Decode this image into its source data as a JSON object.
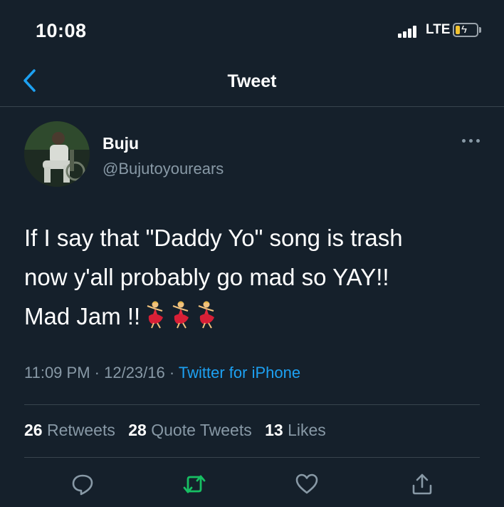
{
  "status_bar": {
    "time": "10:08",
    "network": "LTE"
  },
  "nav": {
    "title": "Tweet"
  },
  "author": {
    "name": "Buju",
    "handle": "@Bujutoyourears"
  },
  "tweet": {
    "line1": "If I say that \"Daddy Yo\" song is trash",
    "line2": "now y'all probably go mad so YAY!!",
    "line3": "Mad Jam !!",
    "emojis": [
      "dancer-emoji",
      "dancer-emoji",
      "dancer-emoji"
    ]
  },
  "meta": {
    "time": "11:09 PM",
    "date": "12/23/16",
    "sep": " · ",
    "source": "Twitter for iPhone"
  },
  "stats": {
    "retweets_count": "26",
    "retweets_label": "Retweets",
    "quotes_count": "28",
    "quotes_label": "Quote Tweets",
    "likes_count": "13",
    "likes_label": "Likes"
  },
  "colors": {
    "background": "#15202b",
    "accent": "#1da1f2",
    "retweet": "#17bf63",
    "muted": "#8899a6",
    "divider": "#38444d"
  },
  "icons": [
    "back-chevron-icon",
    "more-icon",
    "reply-icon",
    "retweet-icon",
    "like-icon",
    "share-icon"
  ]
}
